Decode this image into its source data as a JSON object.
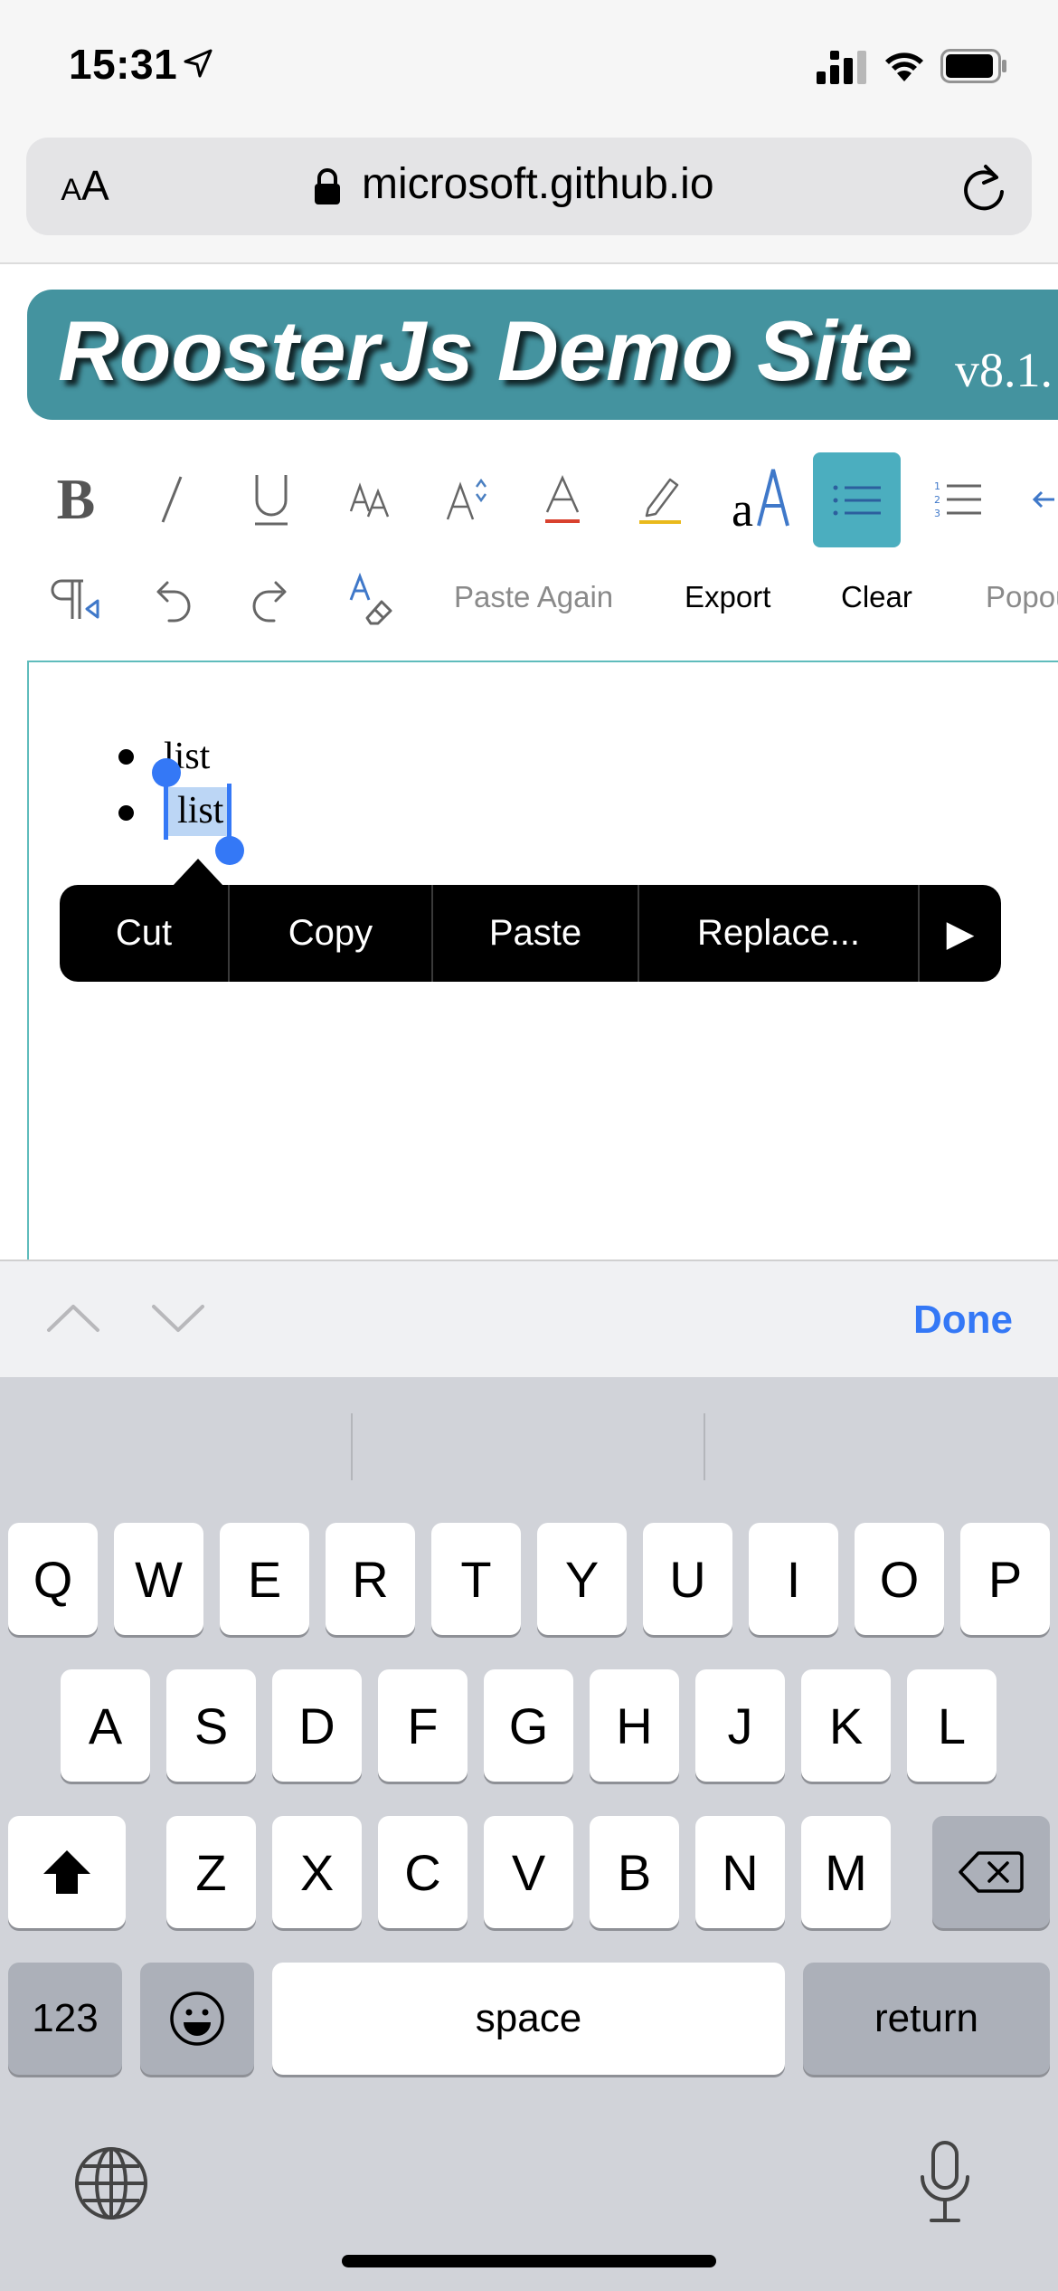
{
  "status_bar": {
    "time": "15:31"
  },
  "browser": {
    "text_size_small": "A",
    "text_size_large": "A",
    "url": "microsoft.github.io"
  },
  "banner": {
    "title": "RoosterJs Demo Site",
    "version": "v8.1."
  },
  "toolbar": {
    "row1": [
      "bold-icon",
      "italic-icon",
      "underline-icon",
      "font-icon",
      "font-size-icon",
      "text-color-icon",
      "highlight-icon",
      "format-painter-icon",
      "bullet-list-icon",
      "numbered-list-icon",
      "outdent-icon"
    ],
    "bold_label": "B",
    "bullets_active_color": "#4baebf",
    "paste_again": "Paste Again",
    "export": "Export",
    "clear": "Clear",
    "popout": "Popou"
  },
  "editor": {
    "list_items": [
      "list",
      "list"
    ],
    "border_color": "#5fbcbc"
  },
  "context_menu": {
    "cut": "Cut",
    "copy": "Copy",
    "paste": "Paste",
    "replace": "Replace...",
    "more": "▶"
  },
  "accessory_bar": {
    "done": "Done",
    "accent_color": "#3478f6"
  },
  "keyboard": {
    "row1": [
      "Q",
      "W",
      "E",
      "R",
      "T",
      "Y",
      "U",
      "I",
      "O",
      "P"
    ],
    "row2": [
      "A",
      "S",
      "D",
      "F",
      "G",
      "H",
      "J",
      "K",
      "L"
    ],
    "row3": [
      "Z",
      "X",
      "C",
      "V",
      "B",
      "N",
      "M"
    ],
    "numbers_key": "123",
    "space_key": "space",
    "return_key": "return"
  }
}
